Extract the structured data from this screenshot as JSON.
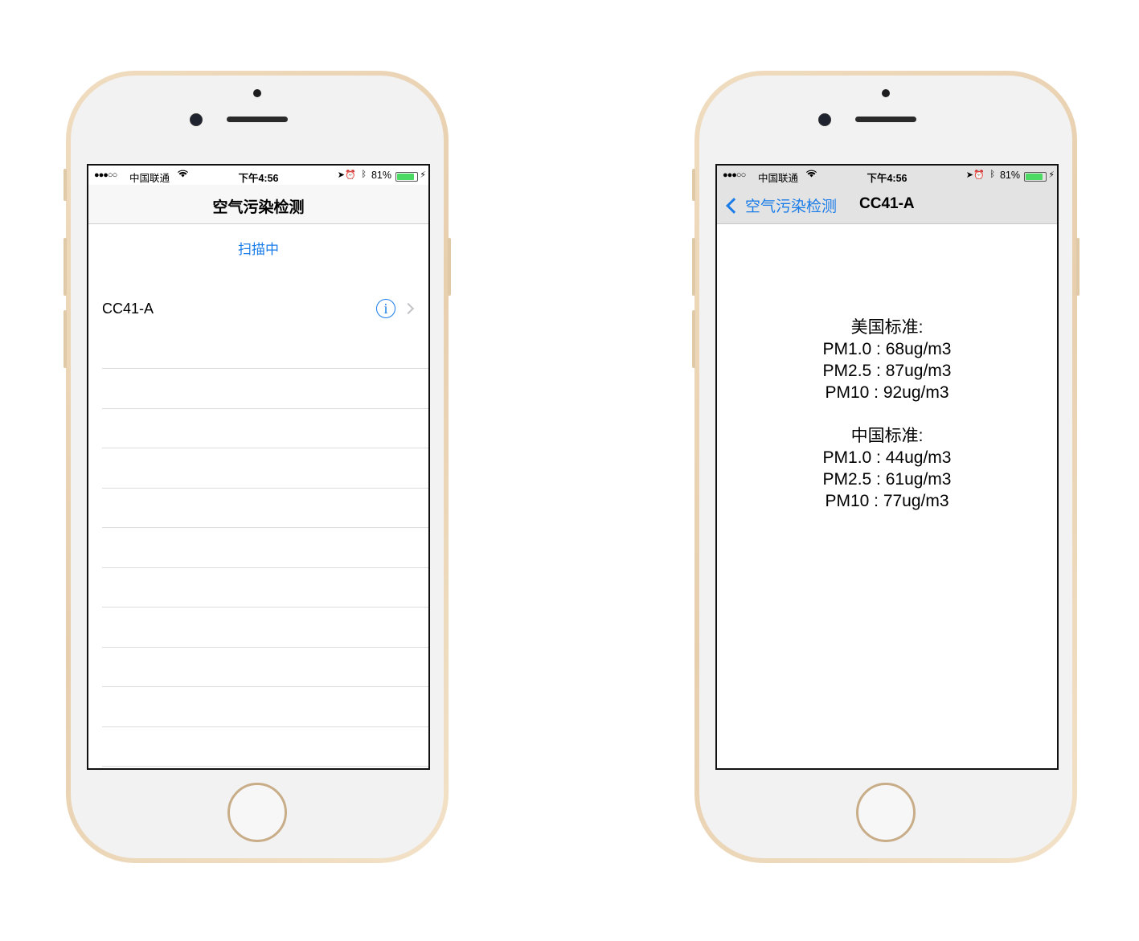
{
  "status_bar": {
    "signal": "●●●○○",
    "carrier": "中国联通",
    "time": "下午4:56",
    "battery": "81%",
    "battery_level": 0.81
  },
  "left_screen": {
    "nav_title": "空气污染检测",
    "scanning_label": "扫描中",
    "devices": [
      {
        "name": "CC41-A"
      }
    ]
  },
  "right_screen": {
    "back_label": "空气污染检测",
    "nav_title": "CC41-A",
    "us_standard": {
      "heading": "美国标准:",
      "pm1": "PM1.0 : 68ug/m3",
      "pm25": "PM2.5 : 87ug/m3",
      "pm10": "PM10 : 92ug/m3"
    },
    "cn_standard": {
      "heading": "中国标准:",
      "pm1": "PM1.0 : 44ug/m3",
      "pm25": "PM2.5 : 61ug/m3",
      "pm10": "PM10 : 77ug/m3"
    }
  },
  "colors": {
    "ios_blue": "#1a7ce8",
    "phone_gold": "#e7cfae",
    "battery_green": "#4cd964"
  }
}
